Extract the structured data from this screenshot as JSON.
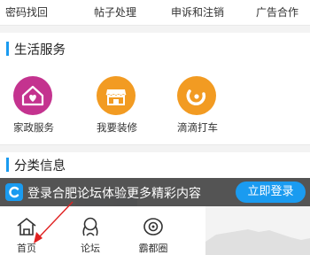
{
  "top_links": [
    "密码找回",
    "帖子处理",
    "申诉和注销",
    "广告合作"
  ],
  "sections": {
    "life_services": "生活服务",
    "classified_info": "分类信息"
  },
  "services": [
    {
      "label": "家政服务",
      "icon": "house-heart-icon",
      "color": "#c4338f"
    },
    {
      "label": "我要装修",
      "icon": "storefront-icon",
      "color": "#f29b22"
    },
    {
      "label": "滴滴打车",
      "icon": "didi-icon",
      "color": "#f29b22"
    }
  ],
  "login_banner": {
    "text": "登录合肥论坛体验更多精彩内容",
    "button": "立即登录"
  },
  "tabs": [
    {
      "label": "首页",
      "icon": "home-icon"
    },
    {
      "label": "论坛",
      "icon": "forum-icon"
    },
    {
      "label": "霸都圈",
      "icon": "circle-icon"
    }
  ],
  "colors": {
    "accent": "#1a9bf0",
    "annotation_arrow": "#e02020"
  }
}
